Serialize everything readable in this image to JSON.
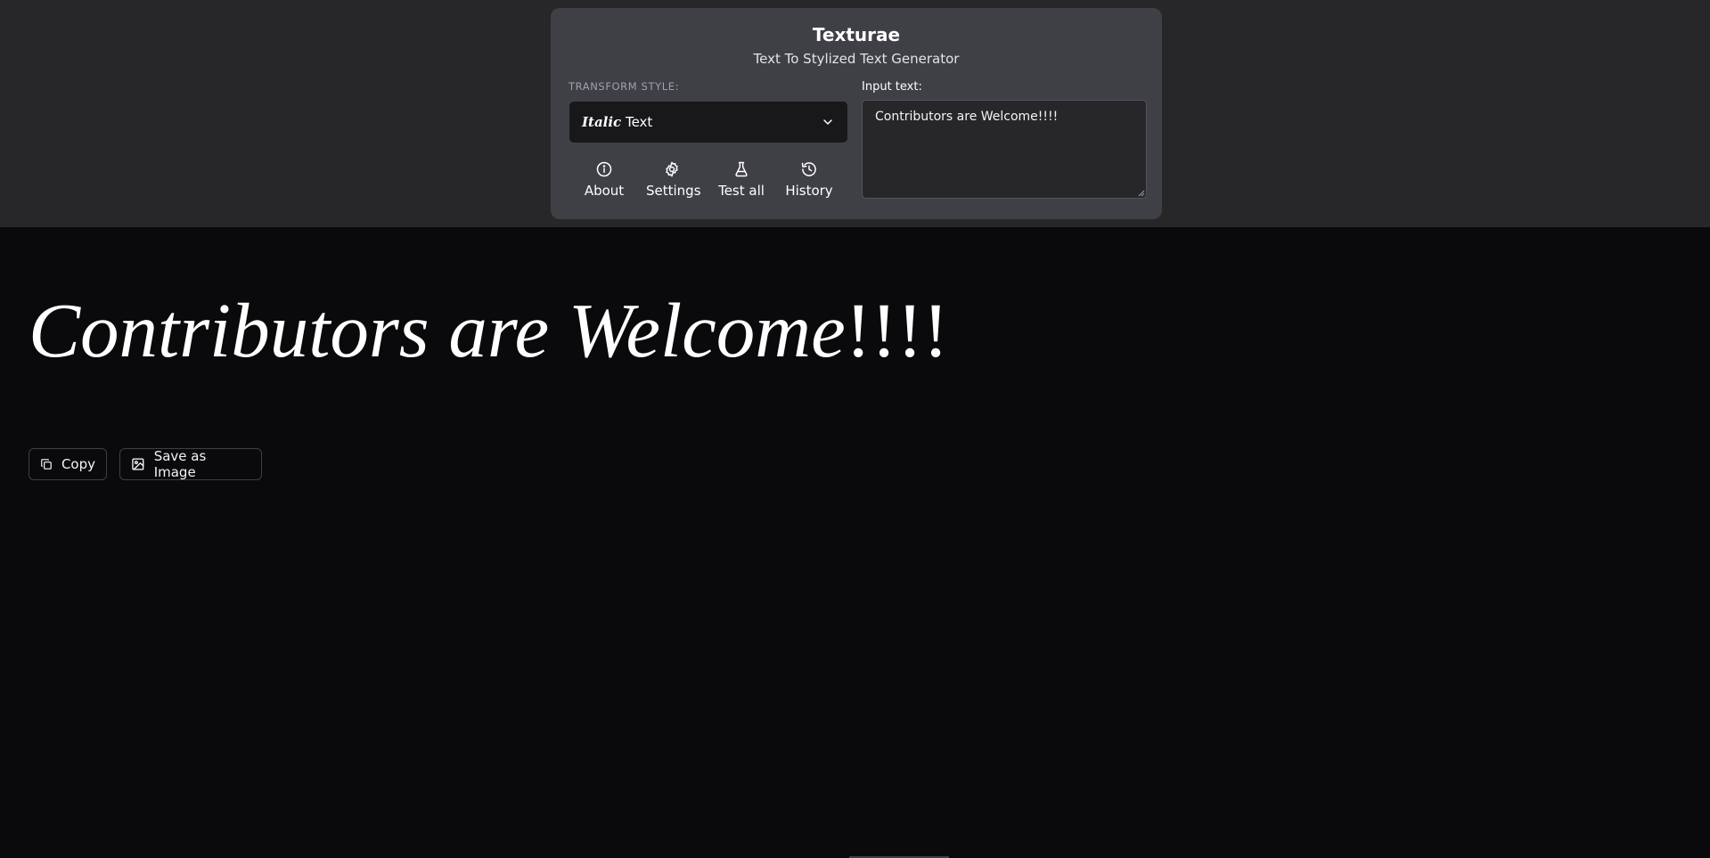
{
  "header": {
    "title": "Texturae",
    "subtitle": "Text To Stylized Text Generator"
  },
  "transform": {
    "label": "TRANSFORM STYLE:",
    "selected_prefix": "Italic",
    "selected_suffix": " Text"
  },
  "actions": [
    {
      "label": "About",
      "icon": "info-icon"
    },
    {
      "label": "Settings",
      "icon": "gear-icon"
    },
    {
      "label": "Test all",
      "icon": "flask-icon"
    },
    {
      "label": "History",
      "icon": "history-icon"
    }
  ],
  "input": {
    "label": "Input text:",
    "value": "Contributors are Welcome!!!!"
  },
  "output": {
    "styled_part": "Contributors are Welcome",
    "plain_part": "!!!!"
  },
  "buttons": {
    "copy": "Copy",
    "save_image": "Save as Image"
  },
  "colors": {
    "page_bg": "#0a0a0c",
    "header_bg": "#27272a",
    "panel_bg": "#3f3f46",
    "select_bg": "#18181b"
  }
}
